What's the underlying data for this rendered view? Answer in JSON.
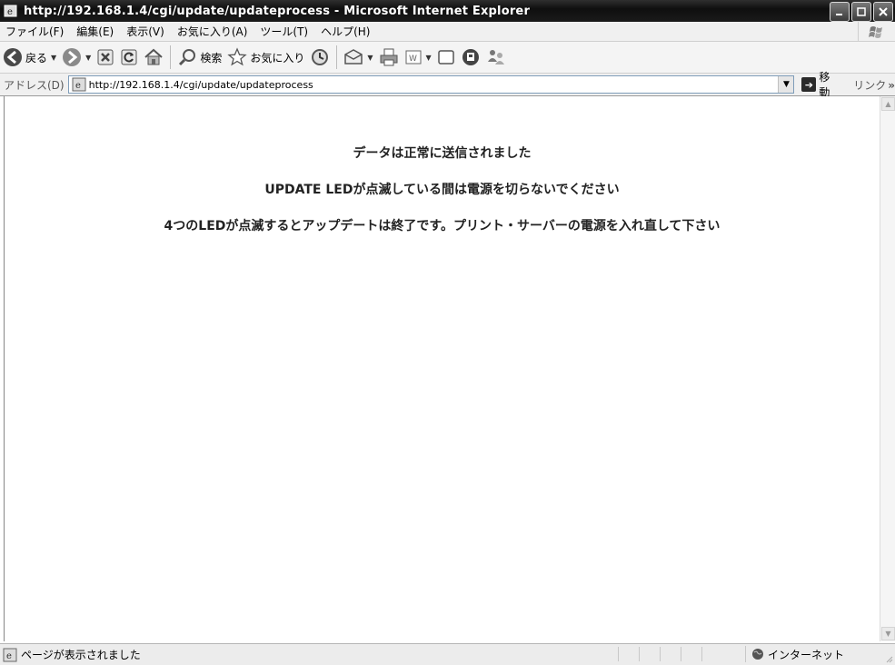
{
  "window": {
    "title": "http://192.168.1.4/cgi/update/updateprocess - Microsoft Internet Explorer"
  },
  "menu": {
    "items": [
      "ファイル(F)",
      "編集(E)",
      "表示(V)",
      "お気に入り(A)",
      "ツール(T)",
      "ヘルプ(H)"
    ]
  },
  "toolbar": {
    "back_label": "戻る",
    "search_label": "検索",
    "favorites_label": "お気に入り"
  },
  "address": {
    "label": "アドレス(D)",
    "url": "http://192.168.1.4/cgi/update/updateprocess",
    "go_label": "移動",
    "links_label": "リンク"
  },
  "content": {
    "line1": "データは正常に送信されました",
    "line2": "UPDATE LEDが点滅している間は電源を切らないでください",
    "line3": "4つのLEDが点滅するとアップデートは終了です。プリント・サーバーの電源を入れ直して下さい"
  },
  "status": {
    "text": "ページが表示されました",
    "zone": "インターネット"
  }
}
